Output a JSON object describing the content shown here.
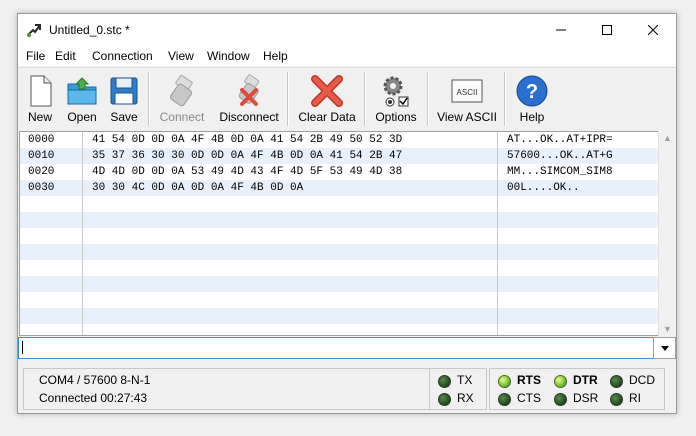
{
  "window": {
    "title": "Untitled_0.stc *"
  },
  "menu": [
    "File",
    "Edit",
    "Connection",
    "View",
    "Window",
    "Help"
  ],
  "toolbar": {
    "new": "New",
    "open": "Open",
    "save": "Save",
    "connect": "Connect",
    "disconnect": "Disconnect",
    "clear": "Clear Data",
    "options": "Options",
    "view_ascii": "View ASCII",
    "help": "Help",
    "ascii_icon_text": "ASCII"
  },
  "data_rows": [
    {
      "offset": "0000",
      "hex": "41 54 0D 0D 0A 4F 4B 0D 0A 41 54 2B 49 50 52 3D",
      "ascii": "AT...OK..AT+IPR="
    },
    {
      "offset": "0010",
      "hex": "35 37 36 30 30 0D 0D 0A 4F 4B 0D 0A 41 54 2B 47",
      "ascii": "57600...OK..AT+G"
    },
    {
      "offset": "0020",
      "hex": "4D 4D 0D 0D 0A 53 49 4D 43 4F 4D 5F 53 49 4D 38",
      "ascii": "MM...SIMCOM_SIM8"
    },
    {
      "offset": "0030",
      "hex": "30 30 4C 0D 0A 0D 0A 4F 4B 0D 0A",
      "ascii": "00L....OK.."
    }
  ],
  "input": {
    "value": ""
  },
  "status": {
    "port": "COM4 / 57600 8-N-1",
    "connected": "Connected 00:27:43"
  },
  "leds": {
    "tx": {
      "label": "TX",
      "on": false
    },
    "rx": {
      "label": "RX",
      "on": false
    },
    "rts": {
      "label": "RTS",
      "on": true
    },
    "cts": {
      "label": "CTS",
      "on": false
    },
    "dtr": {
      "label": "DTR",
      "on": true
    },
    "dsr": {
      "label": "DSR",
      "on": false
    },
    "dcd": {
      "label": "DCD",
      "on": false
    },
    "ri": {
      "label": "RI",
      "on": false
    }
  },
  "colors": {
    "accent": "#3c8dd8",
    "row_alt": "#e8f0fb",
    "close_red": "#e04a3a",
    "help_blue": "#2a6fd0"
  }
}
